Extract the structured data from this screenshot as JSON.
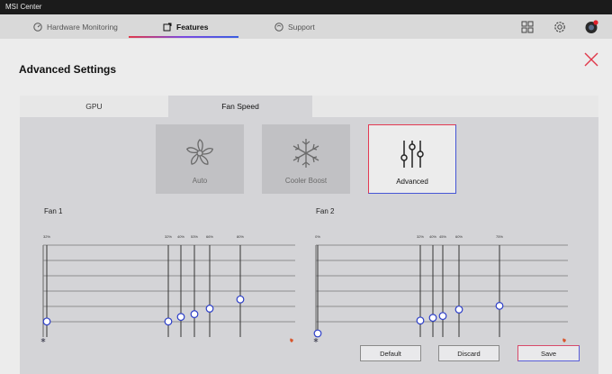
{
  "window": {
    "title": "MSI Center"
  },
  "nav": {
    "items": [
      {
        "label": "Hardware Monitoring",
        "icon": "gauge-icon"
      },
      {
        "label": "Features",
        "icon": "features-icon",
        "active": true
      },
      {
        "label": "Support",
        "icon": "support-icon"
      }
    ]
  },
  "page": {
    "title": "Advanced Settings"
  },
  "tabs": [
    {
      "label": "GPU",
      "active": false
    },
    {
      "label": "Fan Speed",
      "active": true
    }
  ],
  "modes": [
    {
      "label": "Auto",
      "icon": "fan-icon",
      "active": false
    },
    {
      "label": "Cooler Boost",
      "icon": "snowflake-icon",
      "active": false
    },
    {
      "label": "Advanced",
      "icon": "sliders-icon",
      "active": true
    }
  ],
  "fans": [
    {
      "label": "Fan 1",
      "points": [
        {
          "pct_label": "32%",
          "speed": 0.13
        },
        {
          "pct_label": "32%",
          "speed": 0.13
        },
        {
          "pct_label": "40%",
          "speed": 0.18
        },
        {
          "pct_label": "53%",
          "speed": 0.21
        },
        {
          "pct_label": "66%",
          "speed": 0.27
        },
        {
          "pct_label": "80%",
          "speed": 0.37
        }
      ]
    },
    {
      "label": "Fan 2",
      "points": [
        {
          "pct_label": "0%",
          "speed": 0.0
        },
        {
          "pct_label": "32%",
          "speed": 0.14
        },
        {
          "pct_label": "40%",
          "speed": 0.17
        },
        {
          "pct_label": "45%",
          "speed": 0.19
        },
        {
          "pct_label": "60%",
          "speed": 0.26
        },
        {
          "pct_label": "75%",
          "speed": 0.3
        }
      ]
    }
  ],
  "buttons": {
    "default": "Default",
    "discard": "Discard",
    "save": "Save"
  },
  "colors": {
    "accent_red": "#e23a52",
    "accent_blue": "#4656d6"
  }
}
